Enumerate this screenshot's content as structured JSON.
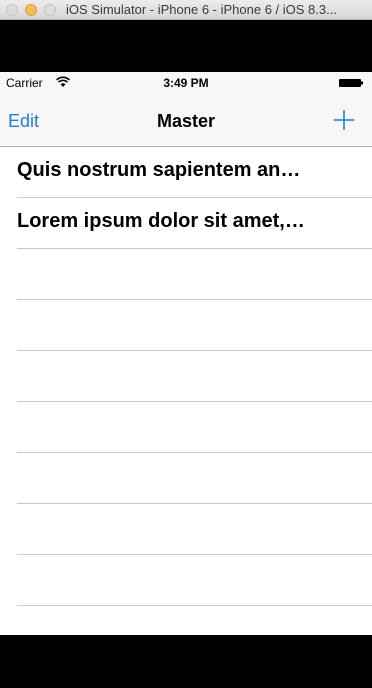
{
  "window": {
    "title": "iOS Simulator - iPhone 6 - iPhone 6 / iOS 8.3..."
  },
  "status_bar": {
    "carrier": "Carrier",
    "time": "3:49 PM"
  },
  "nav_bar": {
    "edit_label": "Edit",
    "title": "Master",
    "add_icon": "plus-icon"
  },
  "list": {
    "items": [
      "Quis nostrum sapientem an…",
      "Lorem ipsum dolor sit amet,…"
    ]
  },
  "colors": {
    "tint": "#1a7bff",
    "separator": "#c8c7cc",
    "bar_background": "#f7f7f7"
  }
}
